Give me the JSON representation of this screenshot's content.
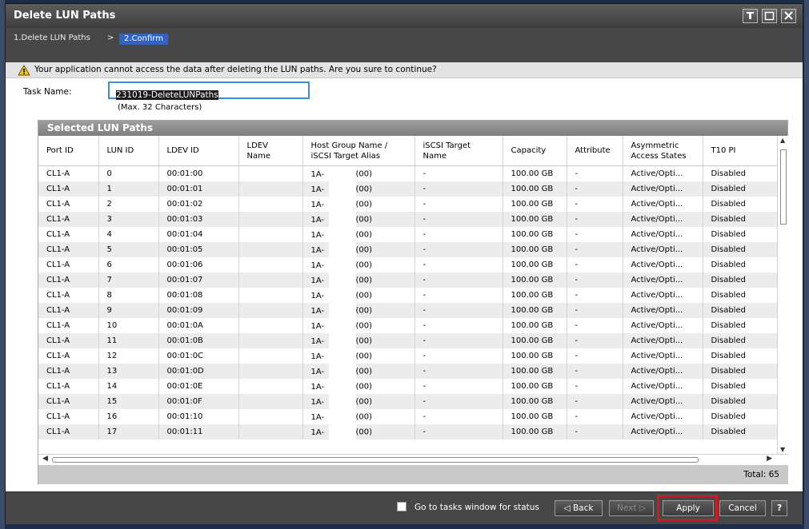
{
  "window": {
    "title": "Delete LUN Paths",
    "controls": [
      "pin-icon",
      "maximize-icon",
      "close-icon"
    ]
  },
  "breadcrumb": {
    "step1": "1.Delete LUN Paths",
    "separator": ">",
    "step2": "2.Confirm"
  },
  "warning": {
    "icon": "warning-triangle-icon",
    "text": "Your application cannot access the data after deleting the LUN paths. Are you sure to continue?"
  },
  "task": {
    "label": "Task Name:",
    "value": "231019-DeleteLUNPaths",
    "hint": "(Max. 32 Characters)"
  },
  "table": {
    "title": "Selected LUN Paths",
    "columns": [
      "Port ID",
      "LUN ID",
      "LDEV ID",
      "LDEV\nName",
      "Host Group Name /\niSCSI Target Alias",
      "iSCSI Target\nName",
      "Capacity",
      "Attribute",
      "Asymmetric\nAccess States",
      "T10 PI"
    ],
    "rows": [
      {
        "port": "CL1-A",
        "lun": "0",
        "ldev": "00:01:00",
        "ldev_name": "",
        "hg_prefix": "1A-",
        "hg_suffix": "(00)",
        "iscsi": "-",
        "capacity": "100.00 GB",
        "attribute": "-",
        "access": "Active/Opti...",
        "t10": "Disabled"
      },
      {
        "port": "CL1-A",
        "lun": "1",
        "ldev": "00:01:01",
        "ldev_name": "",
        "hg_prefix": "1A-",
        "hg_suffix": "(00)",
        "iscsi": "-",
        "capacity": "100.00 GB",
        "attribute": "-",
        "access": "Active/Opti...",
        "t10": "Disabled"
      },
      {
        "port": "CL1-A",
        "lun": "2",
        "ldev": "00:01:02",
        "ldev_name": "",
        "hg_prefix": "1A-",
        "hg_suffix": "(00)",
        "iscsi": "-",
        "capacity": "100.00 GB",
        "attribute": "-",
        "access": "Active/Opti...",
        "t10": "Disabled"
      },
      {
        "port": "CL1-A",
        "lun": "3",
        "ldev": "00:01:03",
        "ldev_name": "",
        "hg_prefix": "1A-",
        "hg_suffix": "(00)",
        "iscsi": "-",
        "capacity": "100.00 GB",
        "attribute": "-",
        "access": "Active/Opti...",
        "t10": "Disabled"
      },
      {
        "port": "CL1-A",
        "lun": "4",
        "ldev": "00:01:04",
        "ldev_name": "",
        "hg_prefix": "1A-",
        "hg_suffix": "(00)",
        "iscsi": "-",
        "capacity": "100.00 GB",
        "attribute": "-",
        "access": "Active/Opti...",
        "t10": "Disabled"
      },
      {
        "port": "CL1-A",
        "lun": "5",
        "ldev": "00:01:05",
        "ldev_name": "",
        "hg_prefix": "1A-",
        "hg_suffix": "(00)",
        "iscsi": "-",
        "capacity": "100.00 GB",
        "attribute": "-",
        "access": "Active/Opti...",
        "t10": "Disabled"
      },
      {
        "port": "CL1-A",
        "lun": "6",
        "ldev": "00:01:06",
        "ldev_name": "",
        "hg_prefix": "1A-",
        "hg_suffix": "(00)",
        "iscsi": "-",
        "capacity": "100.00 GB",
        "attribute": "-",
        "access": "Active/Opti...",
        "t10": "Disabled"
      },
      {
        "port": "CL1-A",
        "lun": "7",
        "ldev": "00:01:07",
        "ldev_name": "",
        "hg_prefix": "1A-",
        "hg_suffix": "(00)",
        "iscsi": "-",
        "capacity": "100.00 GB",
        "attribute": "-",
        "access": "Active/Opti...",
        "t10": "Disabled"
      },
      {
        "port": "CL1-A",
        "lun": "8",
        "ldev": "00:01:08",
        "ldev_name": "",
        "hg_prefix": "1A-",
        "hg_suffix": "(00)",
        "iscsi": "-",
        "capacity": "100.00 GB",
        "attribute": "-",
        "access": "Active/Opti...",
        "t10": "Disabled"
      },
      {
        "port": "CL1-A",
        "lun": "9",
        "ldev": "00:01:09",
        "ldev_name": "",
        "hg_prefix": "1A-",
        "hg_suffix": "(00)",
        "iscsi": "-",
        "capacity": "100.00 GB",
        "attribute": "-",
        "access": "Active/Opti...",
        "t10": "Disabled"
      },
      {
        "port": "CL1-A",
        "lun": "10",
        "ldev": "00:01:0A",
        "ldev_name": "",
        "hg_prefix": "1A-",
        "hg_suffix": "(00)",
        "iscsi": "-",
        "capacity": "100.00 GB",
        "attribute": "-",
        "access": "Active/Opti...",
        "t10": "Disabled"
      },
      {
        "port": "CL1-A",
        "lun": "11",
        "ldev": "00:01:0B",
        "ldev_name": "",
        "hg_prefix": "1A-",
        "hg_suffix": "(00)",
        "iscsi": "-",
        "capacity": "100.00 GB",
        "attribute": "-",
        "access": "Active/Opti...",
        "t10": "Disabled"
      },
      {
        "port": "CL1-A",
        "lun": "12",
        "ldev": "00:01:0C",
        "ldev_name": "",
        "hg_prefix": "1A-",
        "hg_suffix": "(00)",
        "iscsi": "-",
        "capacity": "100.00 GB",
        "attribute": "-",
        "access": "Active/Opti...",
        "t10": "Disabled"
      },
      {
        "port": "CL1-A",
        "lun": "13",
        "ldev": "00:01:0D",
        "ldev_name": "",
        "hg_prefix": "1A-",
        "hg_suffix": "(00)",
        "iscsi": "-",
        "capacity": "100.00 GB",
        "attribute": "-",
        "access": "Active/Opti...",
        "t10": "Disabled"
      },
      {
        "port": "CL1-A",
        "lun": "14",
        "ldev": "00:01:0E",
        "ldev_name": "",
        "hg_prefix": "1A-",
        "hg_suffix": "(00)",
        "iscsi": "-",
        "capacity": "100.00 GB",
        "attribute": "-",
        "access": "Active/Opti...",
        "t10": "Disabled"
      },
      {
        "port": "CL1-A",
        "lun": "15",
        "ldev": "00:01:0F",
        "ldev_name": "",
        "hg_prefix": "1A-",
        "hg_suffix": "(00)",
        "iscsi": "-",
        "capacity": "100.00 GB",
        "attribute": "-",
        "access": "Active/Opti...",
        "t10": "Disabled"
      },
      {
        "port": "CL1-A",
        "lun": "16",
        "ldev": "00:01:10",
        "ldev_name": "",
        "hg_prefix": "1A-",
        "hg_suffix": "(00)",
        "iscsi": "-",
        "capacity": "100.00 GB",
        "attribute": "-",
        "access": "Active/Opti...",
        "t10": "Disabled"
      },
      {
        "port": "CL1-A",
        "lun": "17",
        "ldev": "00:01:11",
        "ldev_name": "",
        "hg_prefix": "1A-",
        "hg_suffix": "(00)",
        "iscsi": "-",
        "capacity": "100.00 GB",
        "attribute": "-",
        "access": "Active/Opti...",
        "t10": "Disabled"
      }
    ],
    "total_label": "Total:",
    "total_value": "65"
  },
  "footer": {
    "checkbox_label": "Go to tasks window for status",
    "checkbox_checked": false,
    "back_label": "Back",
    "next_label": "Next",
    "apply_label": "Apply",
    "cancel_label": "Cancel",
    "help_label": "?",
    "highlight_color": "#e0141e"
  },
  "colors": {
    "accent": "#2e63c9",
    "title_bar": "#474747",
    "input_border": "#3a8ee6"
  }
}
